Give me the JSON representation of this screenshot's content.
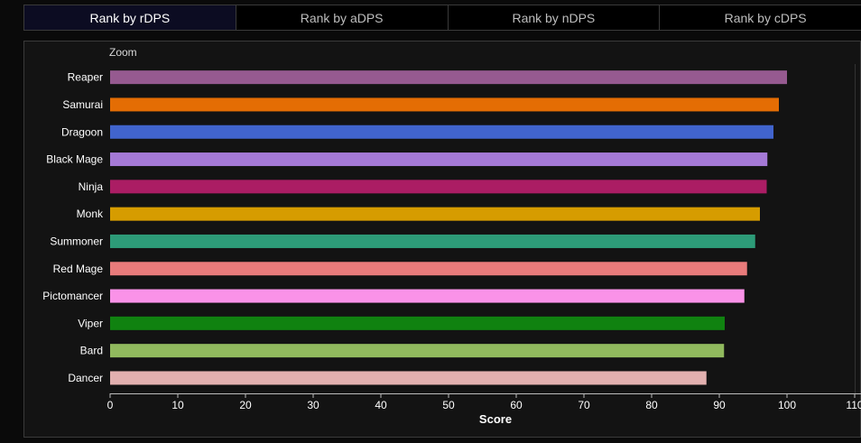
{
  "tabs": [
    {
      "label": "Rank by rDPS",
      "active": true
    },
    {
      "label": "Rank by aDPS",
      "active": false
    },
    {
      "label": "Rank by nDPS",
      "active": false
    },
    {
      "label": "Rank by cDPS",
      "active": false
    }
  ],
  "zoom_label": "Zoom",
  "chart_data": {
    "type": "bar",
    "orientation": "horizontal",
    "xlabel": "Score",
    "ylabel": "",
    "xlim": [
      0,
      110
    ],
    "xticks": [
      0,
      10,
      20,
      30,
      40,
      50,
      60,
      70,
      80,
      90,
      100,
      110
    ],
    "grid": false,
    "categories": [
      "Reaper",
      "Samurai",
      "Dragoon",
      "Black Mage",
      "Ninja",
      "Monk",
      "Summoner",
      "Red Mage",
      "Pictomancer",
      "Viper",
      "Bard",
      "Dancer"
    ],
    "values": [
      100,
      98.8,
      98,
      97.1,
      97,
      96,
      95.3,
      94.1,
      93.7,
      90.8,
      90.7,
      88.1
    ],
    "colors": [
      "#965a90",
      "#e46d04",
      "#4164cd",
      "#a579d6",
      "#ab1d64",
      "#d69c00",
      "#2d9b78",
      "#e87b7b",
      "#fa92e8",
      "#108210",
      "#91ba5e",
      "#e2b0af"
    ]
  }
}
